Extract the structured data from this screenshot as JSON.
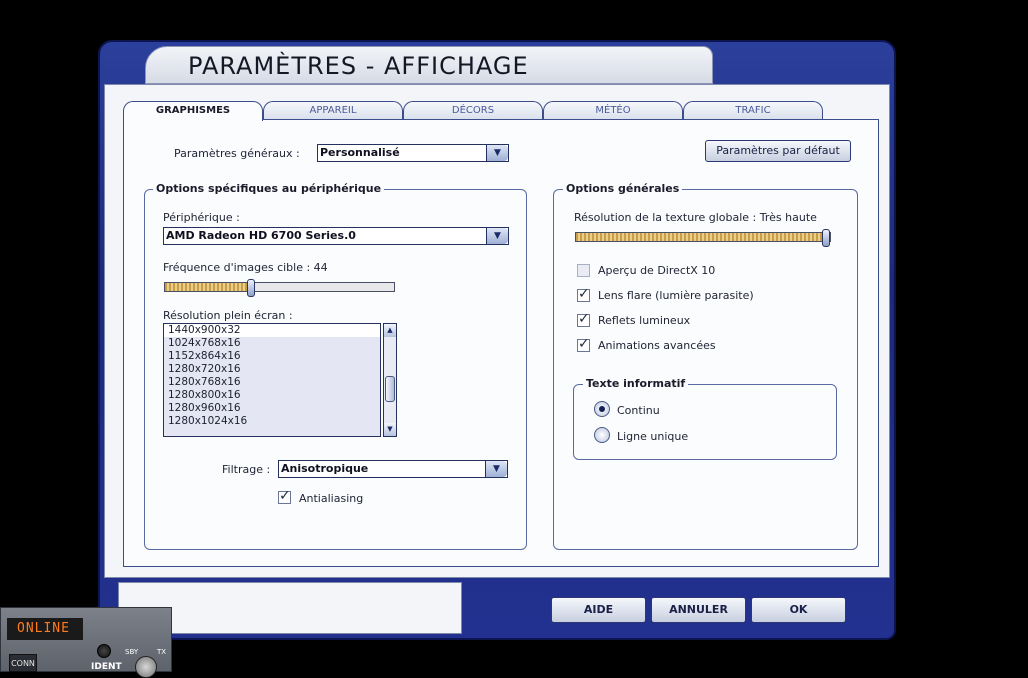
{
  "window": {
    "title": "PARAMÈTRES - AFFICHAGE"
  },
  "tabs": [
    {
      "label": "GRAPHISMES",
      "active": true
    },
    {
      "label": "APPAREIL",
      "active": false
    },
    {
      "label": "DÉCORS",
      "active": false
    },
    {
      "label": "MÉTÉO",
      "active": false
    },
    {
      "label": "TRAFIC",
      "active": false
    }
  ],
  "general": {
    "label": "Paramètres généraux :",
    "value": "Personnalisé",
    "defaults_button": "Paramètres par défaut"
  },
  "device_group": {
    "title": "Options spécifiques au périphérique",
    "device_label": "Périphérique :",
    "device_value": "AMD Radeon HD 6700 Series.0",
    "framerate_label": "Fréquence d'images cible : 44",
    "framerate_level": 0.37,
    "resolution_label": "Résolution plein écran :",
    "resolutions": [
      "1440x900x32",
      "1024x768x16",
      "1152x864x16",
      "1280x720x16",
      "1280x768x16",
      "1280x800x16",
      "1280x960x16",
      "1280x1024x16"
    ],
    "filter_label": "Filtrage :",
    "filter_value": "Anisotropique",
    "antialiasing_label": "Antialiasing",
    "antialiasing_checked": true
  },
  "options_group": {
    "title": "Options générales",
    "texture_label": "Résolution de la texture globale : Très haute",
    "texture_level": 1.0,
    "checkboxes": [
      {
        "label": "Aperçu de DirectX 10",
        "checked": false
      },
      {
        "label": "Lens flare (lumière parasite)",
        "checked": true
      },
      {
        "label": "Reflets lumineux",
        "checked": true
      },
      {
        "label": "Animations avancées",
        "checked": true
      }
    ],
    "info_title": "Texte informatif",
    "radios": [
      {
        "label": "Continu",
        "selected": true
      },
      {
        "label": "Ligne unique",
        "selected": false
      }
    ]
  },
  "buttons": {
    "help": "AIDE",
    "cancel": "ANNULER",
    "ok": "OK"
  },
  "widget": {
    "status": "ONLINE",
    "conn": "CONN",
    "ident": "IDENT",
    "sby": "SBY",
    "tx": "TX"
  }
}
